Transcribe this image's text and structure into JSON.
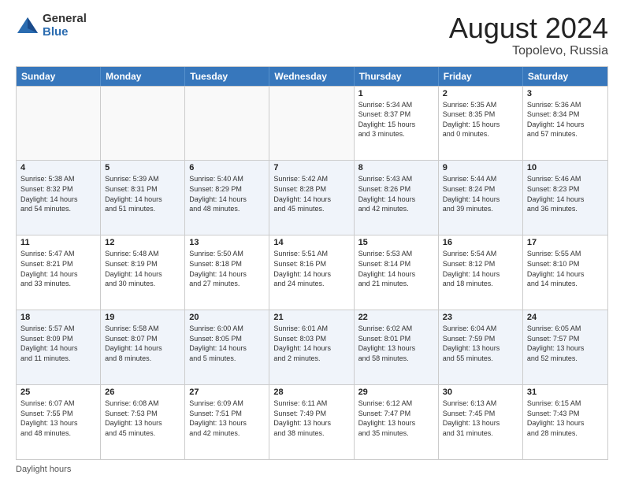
{
  "logo": {
    "general": "General",
    "blue": "Blue"
  },
  "title": "August 2024",
  "subtitle": "Topolevo, Russia",
  "days": [
    "Sunday",
    "Monday",
    "Tuesday",
    "Wednesday",
    "Thursday",
    "Friday",
    "Saturday"
  ],
  "footer": "Daylight hours",
  "weeks": [
    [
      {
        "day": "",
        "text": ""
      },
      {
        "day": "",
        "text": ""
      },
      {
        "day": "",
        "text": ""
      },
      {
        "day": "",
        "text": ""
      },
      {
        "day": "1",
        "text": "Sunrise: 5:34 AM\nSunset: 8:37 PM\nDaylight: 15 hours\nand 3 minutes."
      },
      {
        "day": "2",
        "text": "Sunrise: 5:35 AM\nSunset: 8:35 PM\nDaylight: 15 hours\nand 0 minutes."
      },
      {
        "day": "3",
        "text": "Sunrise: 5:36 AM\nSunset: 8:34 PM\nDaylight: 14 hours\nand 57 minutes."
      }
    ],
    [
      {
        "day": "4",
        "text": "Sunrise: 5:38 AM\nSunset: 8:32 PM\nDaylight: 14 hours\nand 54 minutes."
      },
      {
        "day": "5",
        "text": "Sunrise: 5:39 AM\nSunset: 8:31 PM\nDaylight: 14 hours\nand 51 minutes."
      },
      {
        "day": "6",
        "text": "Sunrise: 5:40 AM\nSunset: 8:29 PM\nDaylight: 14 hours\nand 48 minutes."
      },
      {
        "day": "7",
        "text": "Sunrise: 5:42 AM\nSunset: 8:28 PM\nDaylight: 14 hours\nand 45 minutes."
      },
      {
        "day": "8",
        "text": "Sunrise: 5:43 AM\nSunset: 8:26 PM\nDaylight: 14 hours\nand 42 minutes."
      },
      {
        "day": "9",
        "text": "Sunrise: 5:44 AM\nSunset: 8:24 PM\nDaylight: 14 hours\nand 39 minutes."
      },
      {
        "day": "10",
        "text": "Sunrise: 5:46 AM\nSunset: 8:23 PM\nDaylight: 14 hours\nand 36 minutes."
      }
    ],
    [
      {
        "day": "11",
        "text": "Sunrise: 5:47 AM\nSunset: 8:21 PM\nDaylight: 14 hours\nand 33 minutes."
      },
      {
        "day": "12",
        "text": "Sunrise: 5:48 AM\nSunset: 8:19 PM\nDaylight: 14 hours\nand 30 minutes."
      },
      {
        "day": "13",
        "text": "Sunrise: 5:50 AM\nSunset: 8:18 PM\nDaylight: 14 hours\nand 27 minutes."
      },
      {
        "day": "14",
        "text": "Sunrise: 5:51 AM\nSunset: 8:16 PM\nDaylight: 14 hours\nand 24 minutes."
      },
      {
        "day": "15",
        "text": "Sunrise: 5:53 AM\nSunset: 8:14 PM\nDaylight: 14 hours\nand 21 minutes."
      },
      {
        "day": "16",
        "text": "Sunrise: 5:54 AM\nSunset: 8:12 PM\nDaylight: 14 hours\nand 18 minutes."
      },
      {
        "day": "17",
        "text": "Sunrise: 5:55 AM\nSunset: 8:10 PM\nDaylight: 14 hours\nand 14 minutes."
      }
    ],
    [
      {
        "day": "18",
        "text": "Sunrise: 5:57 AM\nSunset: 8:09 PM\nDaylight: 14 hours\nand 11 minutes."
      },
      {
        "day": "19",
        "text": "Sunrise: 5:58 AM\nSunset: 8:07 PM\nDaylight: 14 hours\nand 8 minutes."
      },
      {
        "day": "20",
        "text": "Sunrise: 6:00 AM\nSunset: 8:05 PM\nDaylight: 14 hours\nand 5 minutes."
      },
      {
        "day": "21",
        "text": "Sunrise: 6:01 AM\nSunset: 8:03 PM\nDaylight: 14 hours\nand 2 minutes."
      },
      {
        "day": "22",
        "text": "Sunrise: 6:02 AM\nSunset: 8:01 PM\nDaylight: 13 hours\nand 58 minutes."
      },
      {
        "day": "23",
        "text": "Sunrise: 6:04 AM\nSunset: 7:59 PM\nDaylight: 13 hours\nand 55 minutes."
      },
      {
        "day": "24",
        "text": "Sunrise: 6:05 AM\nSunset: 7:57 PM\nDaylight: 13 hours\nand 52 minutes."
      }
    ],
    [
      {
        "day": "25",
        "text": "Sunrise: 6:07 AM\nSunset: 7:55 PM\nDaylight: 13 hours\nand 48 minutes."
      },
      {
        "day": "26",
        "text": "Sunrise: 6:08 AM\nSunset: 7:53 PM\nDaylight: 13 hours\nand 45 minutes."
      },
      {
        "day": "27",
        "text": "Sunrise: 6:09 AM\nSunset: 7:51 PM\nDaylight: 13 hours\nand 42 minutes."
      },
      {
        "day": "28",
        "text": "Sunrise: 6:11 AM\nSunset: 7:49 PM\nDaylight: 13 hours\nand 38 minutes."
      },
      {
        "day": "29",
        "text": "Sunrise: 6:12 AM\nSunset: 7:47 PM\nDaylight: 13 hours\nand 35 minutes."
      },
      {
        "day": "30",
        "text": "Sunrise: 6:13 AM\nSunset: 7:45 PM\nDaylight: 13 hours\nand 31 minutes."
      },
      {
        "day": "31",
        "text": "Sunrise: 6:15 AM\nSunset: 7:43 PM\nDaylight: 13 hours\nand 28 minutes."
      }
    ]
  ]
}
